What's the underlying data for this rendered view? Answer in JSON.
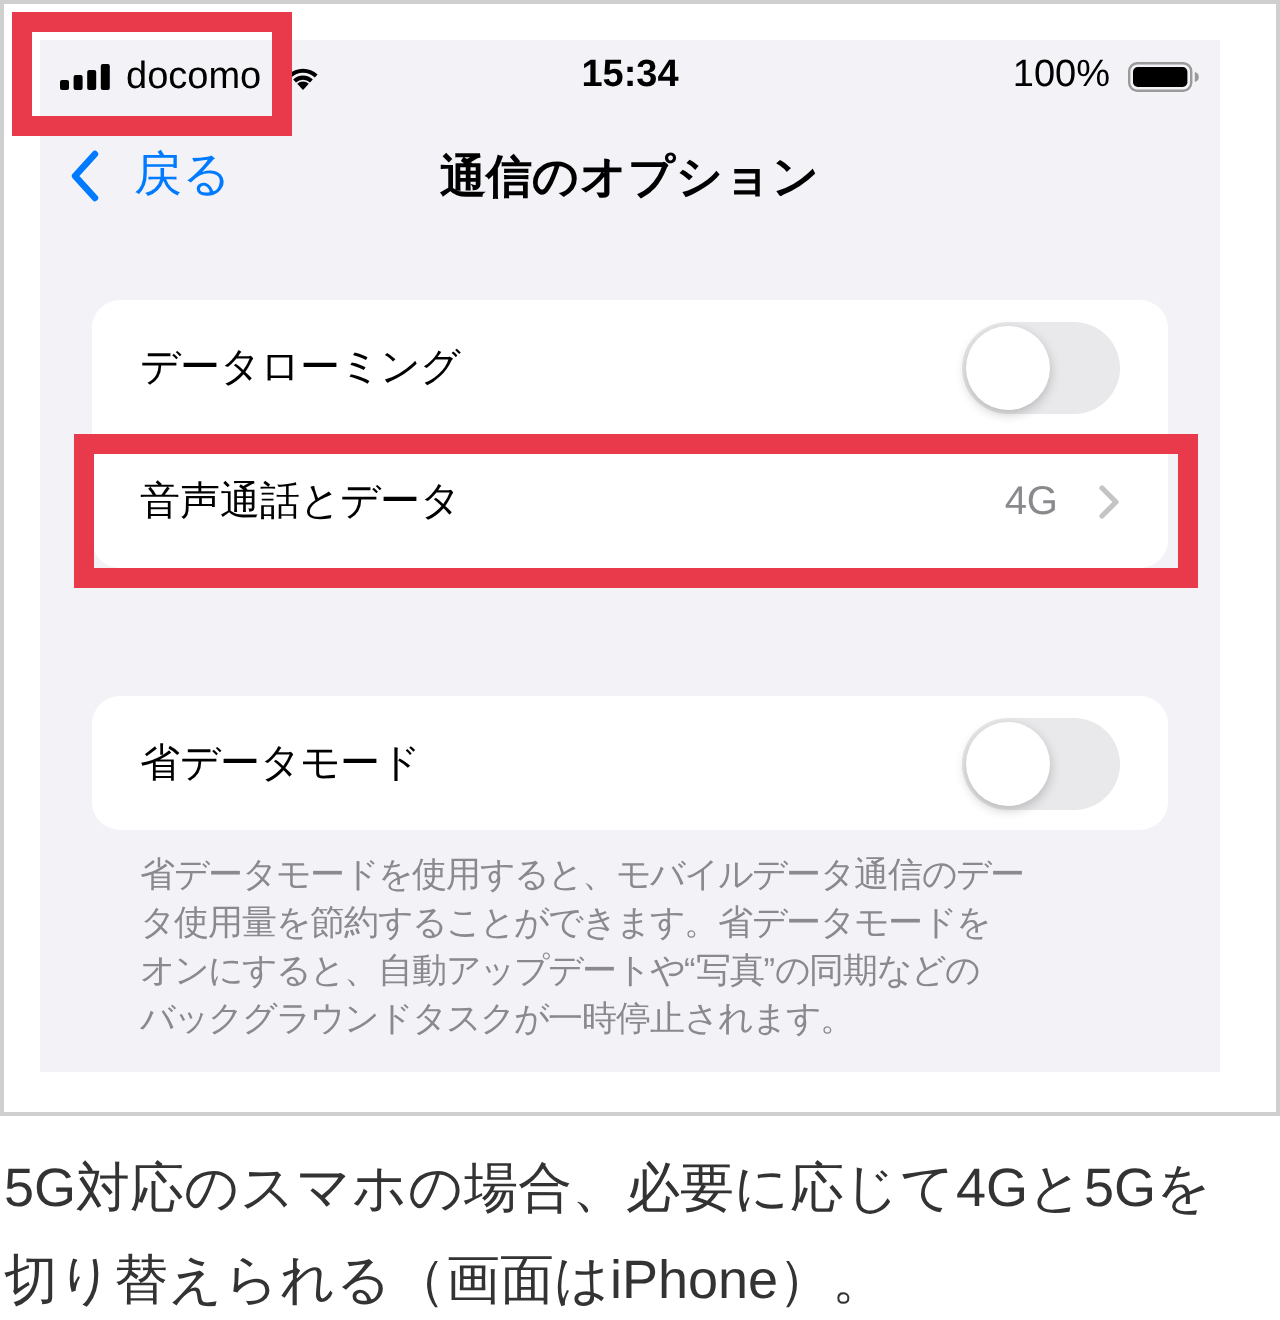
{
  "status_bar": {
    "carrier": "docomo",
    "carrier_highlighted": true,
    "time": "15:34",
    "battery": "100%"
  },
  "nav": {
    "back": "戻る",
    "title": "通信のオプション"
  },
  "groups": [
    {
      "rows": [
        {
          "kind": "toggle",
          "label": "データローミング",
          "on": false,
          "highlighted": false
        },
        {
          "kind": "link",
          "label": "音声通話とデータ",
          "value": "4G",
          "highlighted": true
        }
      ]
    },
    {
      "rows": [
        {
          "kind": "toggle",
          "label": "省データモード",
          "on": false,
          "highlighted": false
        }
      ],
      "footer_lines": [
        "省データモードを使用すると、モバイルデータ通信のデー",
        "タ使用量を節約することができます。省データモードを",
        "オンにすると、自動アップデートや“写真”の同期などの",
        "バックグラウンドタスクが一時停止されます。"
      ]
    }
  ],
  "caption_lines": [
    "5G対応のスマホの場合、必要に応じて4Gと5Gを",
    "切り替えられる（画面はiPhone）。"
  ]
}
